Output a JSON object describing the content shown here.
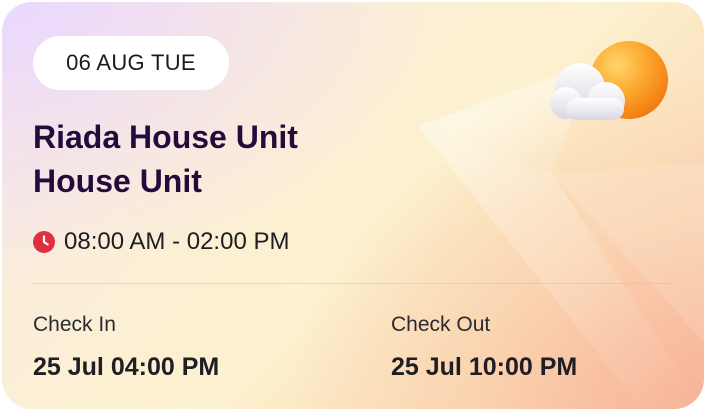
{
  "booking": {
    "date_label": "06 AUG TUE",
    "title_line1": "Riada House Unit",
    "title_line2": "House Unit",
    "time_range": "08:00 AM - 02:00 PM",
    "check_in_label": "Check In",
    "check_in_value": "25 Jul 04:00 PM",
    "check_out_label": "Check Out",
    "check_out_value": "25 Jul 10:00 PM"
  },
  "icons": {
    "clock": "clock-icon",
    "weather": "sun-cloud-icon"
  },
  "colors": {
    "title": "#230c3c",
    "clock": "#e0303f",
    "sun": "#f79a1c"
  }
}
